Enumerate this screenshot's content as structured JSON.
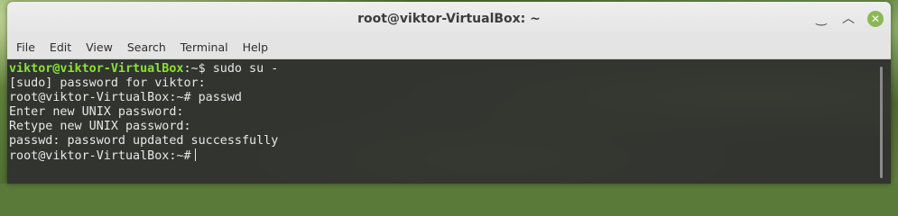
{
  "window": {
    "title": "root@viktor-VirtualBox: ~",
    "controls": {
      "minimize_icon": "‿",
      "maximize_icon": "︿",
      "close_icon": "✕"
    }
  },
  "menu": {
    "items": [
      "File",
      "Edit",
      "View",
      "Search",
      "Terminal",
      "Help"
    ]
  },
  "terminal": {
    "line1": {
      "prompt": "viktor@viktor-VirtualBox",
      "rest": ":~$ sudo su -"
    },
    "line2": "[sudo] password for viktor:",
    "line3": "root@viktor-VirtualBox:~# passwd",
    "line4": "Enter new UNIX password:",
    "line5": "Retype new UNIX password:",
    "line6": "passwd: password updated successfully",
    "line7": "root@viktor-VirtualBox:~#"
  },
  "colors": {
    "prompt_user": "#8ae234",
    "text": "#e8e8e8",
    "close_button": "#8ab954"
  }
}
